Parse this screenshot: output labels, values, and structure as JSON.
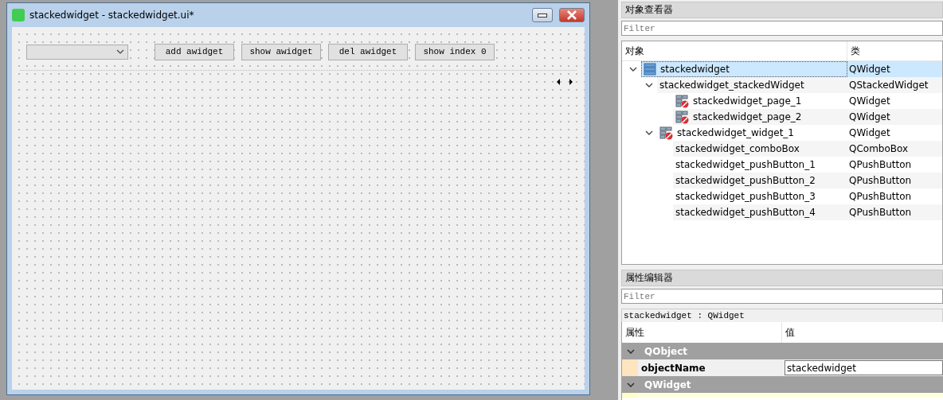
{
  "designer_window": {
    "title": "stackedwidget - stackedwidget.ui*",
    "buttons": [
      "add awidget",
      "show awidget",
      "del awidget",
      "show index 0"
    ]
  },
  "object_inspector": {
    "title": "对象查看器",
    "filter": {
      "placeholder": "Filter"
    },
    "columns": [
      "对象",
      "类"
    ],
    "tree": [
      {
        "name": "stackedwidget",
        "class": "QWidget",
        "kind": "layout",
        "selected": true,
        "expanded": true,
        "children": [
          {
            "name": "stackedwidget_stackedWidget",
            "class": "QStackedWidget",
            "kind": "plain",
            "selected": false,
            "expanded": true,
            "children": [
              {
                "name": "stackedwidget_page_1",
                "class": "QWidget",
                "kind": "unlaid",
                "selected": false
              },
              {
                "name": "stackedwidget_page_2",
                "class": "QWidget",
                "kind": "unlaid",
                "selected": false
              }
            ]
          },
          {
            "name": "stackedwidget_widget_1",
            "class": "QWidget",
            "kind": "unlaid",
            "selected": false,
            "expanded": true,
            "children": [
              {
                "name": "stackedwidget_comboBox",
                "class": "QComboBox",
                "kind": "plain",
                "selected": false
              },
              {
                "name": "stackedwidget_pushButton_1",
                "class": "QPushButton",
                "kind": "plain",
                "selected": false
              },
              {
                "name": "stackedwidget_pushButton_2",
                "class": "QPushButton",
                "kind": "plain",
                "selected": false
              },
              {
                "name": "stackedwidget_pushButton_3",
                "class": "QPushButton",
                "kind": "plain",
                "selected": false
              },
              {
                "name": "stackedwidget_pushButton_4",
                "class": "QPushButton",
                "kind": "plain",
                "selected": false
              }
            ]
          }
        ]
      }
    ]
  },
  "property_editor": {
    "title": "属性编辑器",
    "filter": {
      "placeholder": "Filter"
    },
    "object_label": "stackedwidget : QWidget",
    "columns": [
      "属性",
      "值"
    ],
    "rows": [
      {
        "kind": "group",
        "name": "QObject",
        "expanded": true
      },
      {
        "kind": "property",
        "name": "objectName",
        "value": "stackedwidget"
      },
      {
        "kind": "group",
        "name": "QWidget",
        "expanded": true
      }
    ]
  }
}
